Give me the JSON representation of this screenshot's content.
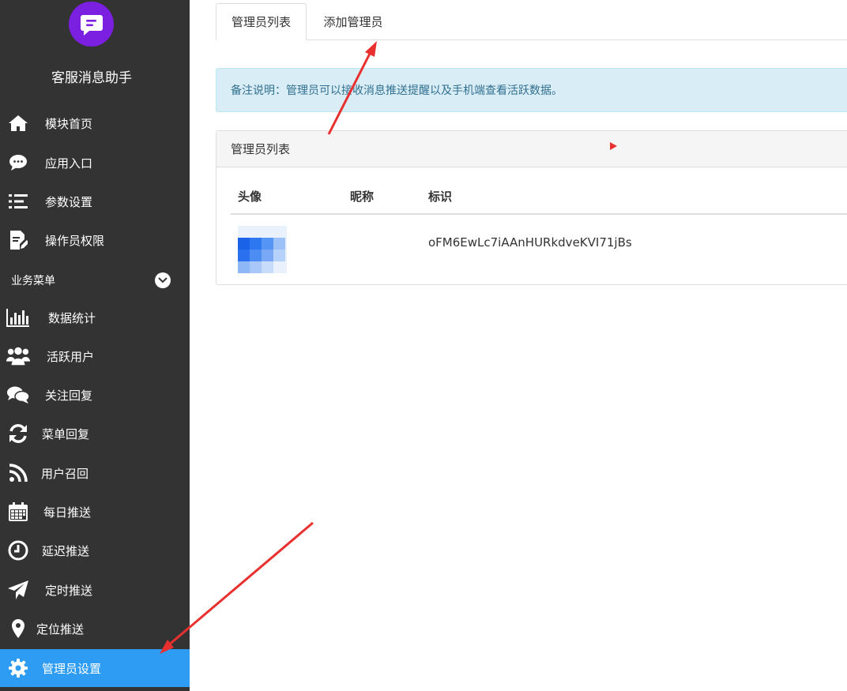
{
  "app": {
    "name": "客服消息助手",
    "logo_icon": "chat-message-icon",
    "brand_color": "#7b1fe0"
  },
  "sidebar": {
    "items": [
      {
        "label": "模块首页",
        "icon": "home-icon"
      },
      {
        "label": "应用入口",
        "icon": "comment-icon"
      },
      {
        "label": "参数设置",
        "icon": "list-settings-icon"
      },
      {
        "label": "操作员权限",
        "icon": "edit-document-icon"
      }
    ],
    "section": {
      "label": "业务菜单",
      "icon": "chevron-down-icon"
    },
    "business_items": [
      {
        "label": "数据统计",
        "icon": "bar-chart-icon"
      },
      {
        "label": "活跃用户",
        "icon": "users-icon"
      },
      {
        "label": "关注回复",
        "icon": "comments-icon"
      },
      {
        "label": "菜单回复",
        "icon": "refresh-icon"
      },
      {
        "label": "用户召回",
        "icon": "rss-icon"
      },
      {
        "label": "每日推送",
        "icon": "calendar-icon"
      },
      {
        "label": "延迟推送",
        "icon": "clock-icon"
      },
      {
        "label": "定时推送",
        "icon": "paper-plane-icon"
      },
      {
        "label": "定位推送",
        "icon": "map-marker-icon"
      },
      {
        "label": "管理员设置",
        "icon": "gear-icon",
        "active": true
      }
    ],
    "active_color": "#2e9cf3"
  },
  "tabs": [
    {
      "label": "管理员列表",
      "active": true
    },
    {
      "label": "添加管理员",
      "active": false
    }
  ],
  "notice": {
    "text": "备注说明：管理员可以接收消息推送提醒以及手机端查看活跃数据。"
  },
  "panel": {
    "title": "管理员列表",
    "columns": [
      "头像",
      "昵称",
      "标识"
    ],
    "rows": [
      {
        "avatar": "blurred-avatar",
        "nickname": "",
        "id": "oFM6EwLc7iAAnHURkdveKVI71jBs"
      }
    ]
  },
  "annotation_color": "#e8312f"
}
